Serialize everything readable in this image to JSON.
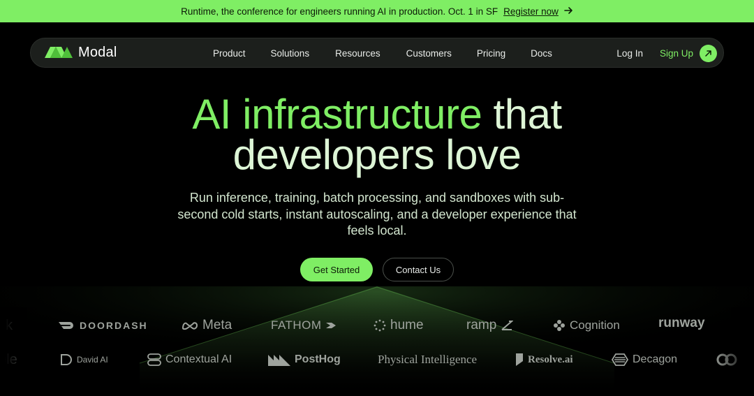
{
  "banner": {
    "text": "Runtime, the conference for engineers running AI in production. Oct. 1 in SF",
    "link": "Register now",
    "arrow_icon": "arrow-right-icon"
  },
  "nav": {
    "brand": "Modal",
    "links": [
      "Product",
      "Solutions",
      "Resources",
      "Customers",
      "Pricing",
      "Docs"
    ],
    "login": "Log In",
    "signup": "Sign Up",
    "signup_icon": "arrow-up-right-icon"
  },
  "hero": {
    "title_accent": "AI infrastructure",
    "title_rest_1": " that",
    "title_line_2": "developers love",
    "subtitle": "Run inference, training, batch processing, and sandboxes with sub-second cold starts, instant autoscaling, and a developer experience that feels local.",
    "primary_cta": "Get Started",
    "secondary_cta": "Contact Us"
  },
  "logos": {
    "row1": [
      "ck",
      "DOORDASH",
      "Meta",
      "FATHOM",
      "hume",
      "ramp",
      "Cognition",
      "runway"
    ],
    "row2": [
      "ple",
      "David AI",
      "Contextual AI",
      "PostHog",
      "Physical Intelligence",
      "Resolve.ai",
      "Decagon"
    ]
  },
  "colors": {
    "accent": "#7fee64",
    "background": "#000000",
    "nav_bg": "#1c1f1c",
    "text": "#ddf5d6"
  }
}
